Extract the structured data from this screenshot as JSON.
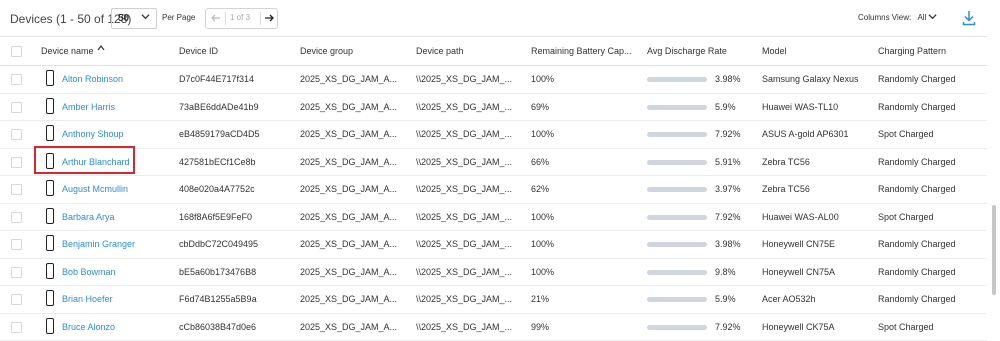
{
  "toolbar": {
    "count_label": "Devices (1 - 50 of 128)",
    "per_page_value": "50",
    "per_page_label": "Per Page",
    "page_info": "1 of 3",
    "columns_view_label": "Columns View:",
    "columns_view_value": "All"
  },
  "columns": [
    "Device name",
    "Device ID",
    "Device group",
    "Device path",
    "Remaining Battery Cap...",
    "Avg Discharge Rate",
    "Model",
    "Charging Pattern"
  ],
  "rows": [
    {
      "name": "Alton Robinson",
      "id": "D7c0F44E717f314",
      "group": "2025_XS_DG_JAM_A...",
      "path": "\\\\2025_XS_DG_JAM_...",
      "battery": "100%",
      "rate": "3.98%",
      "rate_fill": 0.62,
      "model": "Samsung Galaxy Nexus",
      "pattern": "Randomly Charged"
    },
    {
      "name": "Amber Harris",
      "id": "73aBE6ddADe41b9",
      "group": "2025_XS_DG_JAM_A...",
      "path": "\\\\2025_XS_DG_JAM_...",
      "battery": "69%",
      "rate": "5.9%",
      "rate_fill": 0.62,
      "model": "Huawei WAS-TL10",
      "pattern": "Randomly Charged"
    },
    {
      "name": "Anthony Shoup",
      "id": "eB4859179aCD4D5",
      "group": "2025_XS_DG_JAM_A...",
      "path": "\\\\2025_XS_DG_JAM_...",
      "battery": "100%",
      "rate": "7.92%",
      "rate_fill": 0.62,
      "model": "ASUS A-gold AP6301",
      "pattern": "Spot Charged"
    },
    {
      "name": "Arthur Blanchard",
      "id": "427581bECf1Ce8b",
      "group": "2025_XS_DG_JAM_A...",
      "path": "\\\\2025_XS_DG_JAM_...",
      "battery": "66%",
      "rate": "5.91%",
      "rate_fill": 0.62,
      "model": "Zebra TC56",
      "pattern": "Randomly Charged"
    },
    {
      "name": "August Mcmullin",
      "id": "408e020a4A7752c",
      "group": "2025_XS_DG_JAM_A...",
      "path": "\\\\2025_XS_DG_JAM_...",
      "battery": "62%",
      "rate": "3.97%",
      "rate_fill": 0.62,
      "model": "Zebra TC56",
      "pattern": "Randomly Charged"
    },
    {
      "name": "Barbara Arya",
      "id": "168f8A6f5E9FeF0",
      "group": "2025_XS_DG_JAM_A...",
      "path": "\\\\2025_XS_DG_JAM_...",
      "battery": "100%",
      "rate": "7.92%",
      "rate_fill": 0.62,
      "model": "Huawei WAS-AL00",
      "pattern": "Spot Charged"
    },
    {
      "name": "Benjamin Granger",
      "id": "cbDdbC72C049495",
      "group": "2025_XS_DG_JAM_A...",
      "path": "\\\\2025_XS_DG_JAM_...",
      "battery": "100%",
      "rate": "3.98%",
      "rate_fill": 0.62,
      "model": "Honeywell CN75E",
      "pattern": "Randomly Charged"
    },
    {
      "name": "Bob Bowman",
      "id": "bE5a60b173476B8",
      "group": "2025_XS_DG_JAM_A...",
      "path": "\\\\2025_XS_DG_JAM_...",
      "battery": "100%",
      "rate": "9.8%",
      "rate_fill": 0.62,
      "model": "Honeywell CN75A",
      "pattern": "Randomly Charged"
    },
    {
      "name": "Brian Hoefer",
      "id": "F6d74B1255a5B9a",
      "group": "2025_XS_DG_JAM_A...",
      "path": "\\\\2025_XS_DG_JAM_...",
      "battery": "21%",
      "rate": "5.9%",
      "rate_fill": 0.62,
      "model": "Acer AO532h",
      "pattern": "Randomly Charged"
    },
    {
      "name": "Bruce Alonzo",
      "id": "cCb86038B47d0e6",
      "group": "2025_XS_DG_JAM_A...",
      "path": "\\\\2025_XS_DG_JAM_...",
      "battery": "99%",
      "rate": "7.92%",
      "rate_fill": 0.62,
      "model": "Honeywell CK75A",
      "pattern": "Spot Charged"
    }
  ],
  "icons": {
    "per_page_chevron": "chevron-down-icon",
    "prev": "arrow-left-icon",
    "next": "arrow-right-icon",
    "columns_chevron": "chevron-down-icon",
    "download": "download-icon",
    "sort": "chevron-up-icon",
    "device": "phone-icon"
  },
  "colors": {
    "link": "#2d8fd5",
    "highlight": "#d9272e",
    "bar_track": "#cfd6de",
    "bar_fill": "#a6b2bf",
    "download_icon": "#2d8fd5"
  }
}
